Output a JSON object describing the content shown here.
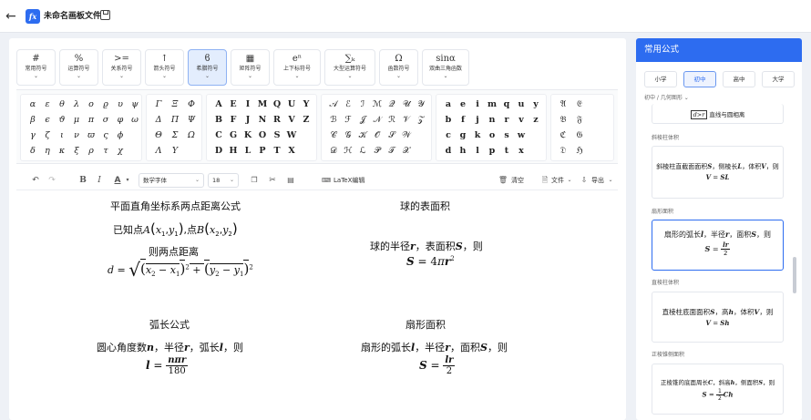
{
  "header": {
    "back_icon": "arrow-left-icon",
    "logo_text": "fx",
    "file_title": "未命名画板文件",
    "save_icon": "floppy-icon"
  },
  "categories": [
    {
      "icon": "#",
      "label": "常用符号"
    },
    {
      "icon": "%",
      "label": "运算符号"
    },
    {
      "icon": ">=",
      "label": "关系符号"
    },
    {
      "icon": "↑",
      "label": "箭头符号"
    },
    {
      "icon": "ϐ",
      "label": "希腊符号"
    },
    {
      "icon": "▦",
      "label": "矩阵符号"
    },
    {
      "icon": "eⁿ",
      "label": "上下标符号"
    },
    {
      "icon": "∑ₖ",
      "label": "大型运算符号"
    },
    {
      "icon": "Ω",
      "label": "函数符号"
    },
    {
      "icon": "sinα",
      "label": "双曲三角函数"
    }
  ],
  "symbol_groups": {
    "greek_lower": [
      [
        "α",
        "ε",
        "θ",
        "λ",
        "ο",
        "ϱ",
        "υ",
        "ψ"
      ],
      [
        "β",
        "ϵ",
        "ϑ",
        "μ",
        "π",
        "σ",
        "φ",
        "ω"
      ],
      [
        "γ",
        "ζ",
        "ι",
        "ν",
        "ϖ",
        "ς",
        "ϕ",
        ""
      ],
      [
        "δ",
        "η",
        "κ",
        "ξ",
        "ρ",
        "τ",
        "χ",
        ""
      ]
    ],
    "greek_upper": [
      [
        "Γ",
        "Ξ",
        "Φ"
      ],
      [
        "Δ",
        "Π",
        "Ψ"
      ],
      [
        "Θ",
        "Σ",
        "Ω"
      ],
      [
        "Λ",
        "Υ",
        ""
      ]
    ],
    "bold_upper": [
      [
        "A",
        "E",
        "I",
        "M",
        "Q",
        "U",
        "Y"
      ],
      [
        "B",
        "F",
        "J",
        "N",
        "R",
        "V",
        "Z"
      ],
      [
        "C",
        "G",
        "K",
        "O",
        "S",
        "W",
        ""
      ],
      [
        "D",
        "H",
        "L",
        "P",
        "T",
        "X",
        ""
      ]
    ],
    "script_upper": [
      [
        "𝒜",
        "ℰ",
        "ℐ",
        "ℳ",
        "𝒬",
        "𝒰",
        "𝒴"
      ],
      [
        "ℬ",
        "ℱ",
        "𝒥",
        "𝒩",
        "ℛ",
        "𝒱",
        "𝒵"
      ],
      [
        "𝒞",
        "𝒢",
        "𝒦",
        "𝒪",
        "𝒮",
        "𝒲",
        ""
      ],
      [
        "𝒟",
        "ℋ",
        "ℒ",
        "𝒫",
        "𝒯",
        "𝒳",
        ""
      ]
    ],
    "bold_lower": [
      [
        "a",
        "e",
        "i",
        "m",
        "q",
        "u",
        "y"
      ],
      [
        "b",
        "f",
        "j",
        "n",
        "r",
        "v",
        "z"
      ],
      [
        "c",
        "g",
        "k",
        "o",
        "s",
        "w",
        ""
      ],
      [
        "d",
        "h",
        "l",
        "p",
        "t",
        "x",
        ""
      ]
    ],
    "fraktur_upper": [
      [
        "𝔄",
        "𝔈"
      ],
      [
        "𝔅",
        "𝔉"
      ],
      [
        "ℭ",
        "𝔊"
      ],
      [
        "𝔇",
        "ℌ"
      ]
    ]
  },
  "toolbar": {
    "font_family": "数学字体",
    "font_size": "18",
    "latex_label": "LaTeX编辑",
    "clear_label": "清空",
    "file_label": "文件",
    "export_label": "导出"
  },
  "formulas": {
    "distance": {
      "title": "平面直角坐标系两点距离公式",
      "line1_prefix": "已知点",
      "line1_mid": ",点",
      "line2": "则两点距离"
    },
    "sphere": {
      "title": "球的表面积",
      "line1_a": "球的半径",
      "line1_b": "，表面积",
      "line1_c": "，则"
    },
    "arc": {
      "title": "弧长公式",
      "line1_a": "圆心角度数",
      "line1_b": "，半径",
      "line1_c": "，弧长",
      "line1_d": "，则"
    },
    "sector": {
      "title": "扇形面积",
      "line1_a": "扇形的弧长",
      "line1_b": "，半径",
      "line1_c": "，面积",
      "line1_d": "，则"
    }
  },
  "sidebar": {
    "title": "常用公式",
    "levels": [
      "小学",
      "初中",
      "高中",
      "大学"
    ],
    "active_level": "初中",
    "breadcrumb": "初中 / 几何图形",
    "top_card_text": "直线与圆相离",
    "sections": [
      {
        "label": "斜棱柱体积",
        "text_a": "斜棱柱直截面面积",
        "text_b": "，侧棱长",
        "text_c": "，体积",
        "text_d": "，则"
      },
      {
        "label": "扇形面积",
        "text_a": "扇形的弧长",
        "text_b": "，半径",
        "text_c": "，面积",
        "text_d": "，则"
      },
      {
        "label": "直棱柱体积",
        "text_a": "直棱柱底面面积",
        "text_b": "，高",
        "text_c": "，体积",
        "text_d": "，则"
      },
      {
        "label": "正棱锥侧面积",
        "text_a": "正棱锥的底面周长",
        "text_b": "，斜高",
        "text_c": "，侧面积",
        "text_d": "，则"
      }
    ]
  },
  "colors": {
    "accent": "#2d6cf0",
    "active_tab_bg": "#e3edfd"
  }
}
